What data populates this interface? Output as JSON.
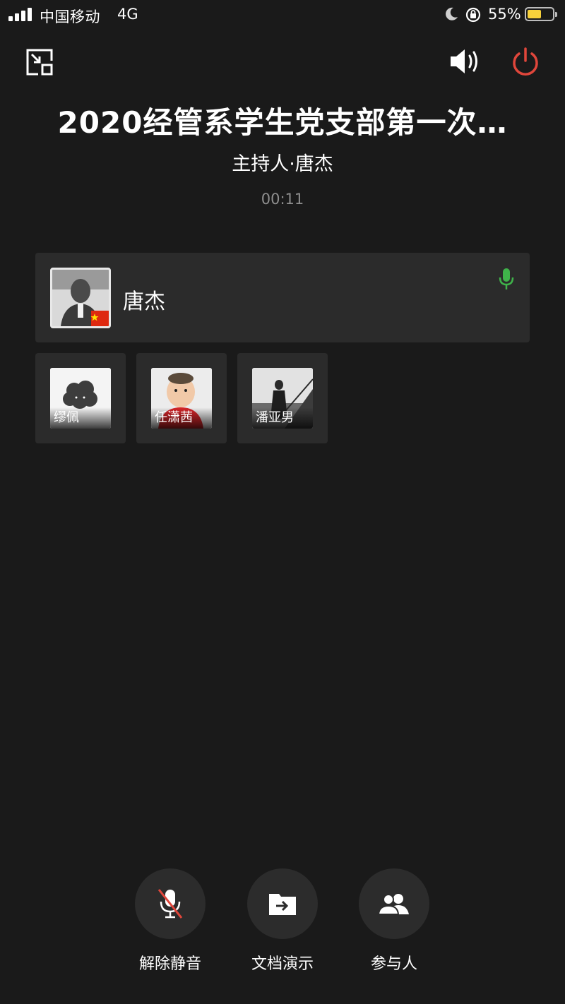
{
  "status_bar": {
    "carrier": "中国移动",
    "network": "4G",
    "battery_percent": "55%",
    "battery_level": 0.55,
    "battery_color": "#f7d13b"
  },
  "toolbar": {
    "minimize_icon": "minimize-window-icon",
    "speaker_icon": "speaker-icon",
    "end_call_icon": "power-icon",
    "end_call_color": "#e0463b"
  },
  "meeting": {
    "title": "2020经管系学生党支部第一次…",
    "host_line": "主持人·唐杰",
    "elapsed": "00:11"
  },
  "host_card": {
    "name": "唐杰",
    "mic_icon": "microphone-icon",
    "mic_color": "#3fb34a"
  },
  "participants": [
    {
      "name": "缪佩"
    },
    {
      "name": "任潇茜"
    },
    {
      "name": "潘亚男"
    }
  ],
  "controls": {
    "unmute_label": "解除静音",
    "share_doc_label": "文档演示",
    "participants_label": "参与人"
  }
}
